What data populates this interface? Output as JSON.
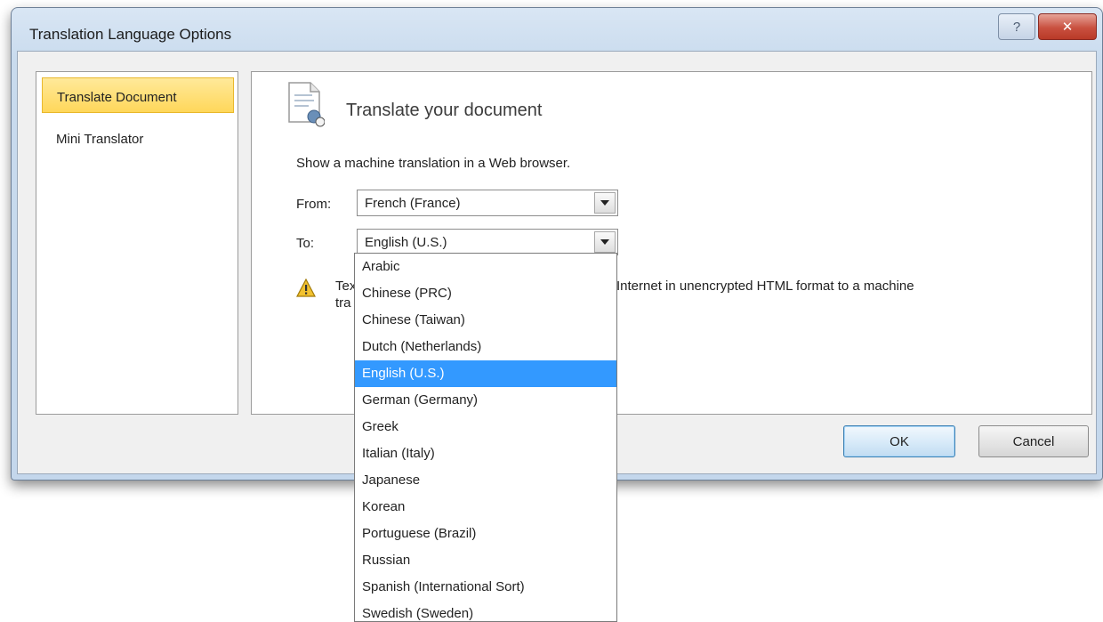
{
  "window": {
    "title": "Translation Language Options",
    "help_icon_glyph": "?",
    "close_icon_glyph": "✕"
  },
  "nav": {
    "items": [
      {
        "label": "Translate Document",
        "selected": true
      },
      {
        "label": "Mini Translator",
        "selected": false
      }
    ]
  },
  "content": {
    "heading": "Translate your document",
    "description": "Show a machine translation in a Web browser.",
    "from_label": "From:",
    "from_value": "French (France)",
    "to_label": "To:",
    "to_value": "English (U.S.)",
    "warning_visible_left": "Tex",
    "warning_visible_right": "Internet in unencrypted HTML format to a machine",
    "warning_line2_visible": "tra"
  },
  "buttons": {
    "ok": "OK",
    "cancel": "Cancel"
  },
  "dropdown": {
    "selected": "English (U.S.)",
    "options": [
      "Arabic",
      "Chinese (PRC)",
      "Chinese (Taiwan)",
      "Dutch (Netherlands)",
      "English (U.S.)",
      "German (Germany)",
      "Greek",
      "Italian (Italy)",
      "Japanese",
      "Korean",
      "Portuguese (Brazil)",
      "Russian",
      "Spanish (International Sort)",
      "Swedish (Sweden)"
    ]
  },
  "colors": {
    "selection_highlight": "#3399ff",
    "nav_selected": "#ffd75a",
    "close_button": "#c9503f"
  }
}
